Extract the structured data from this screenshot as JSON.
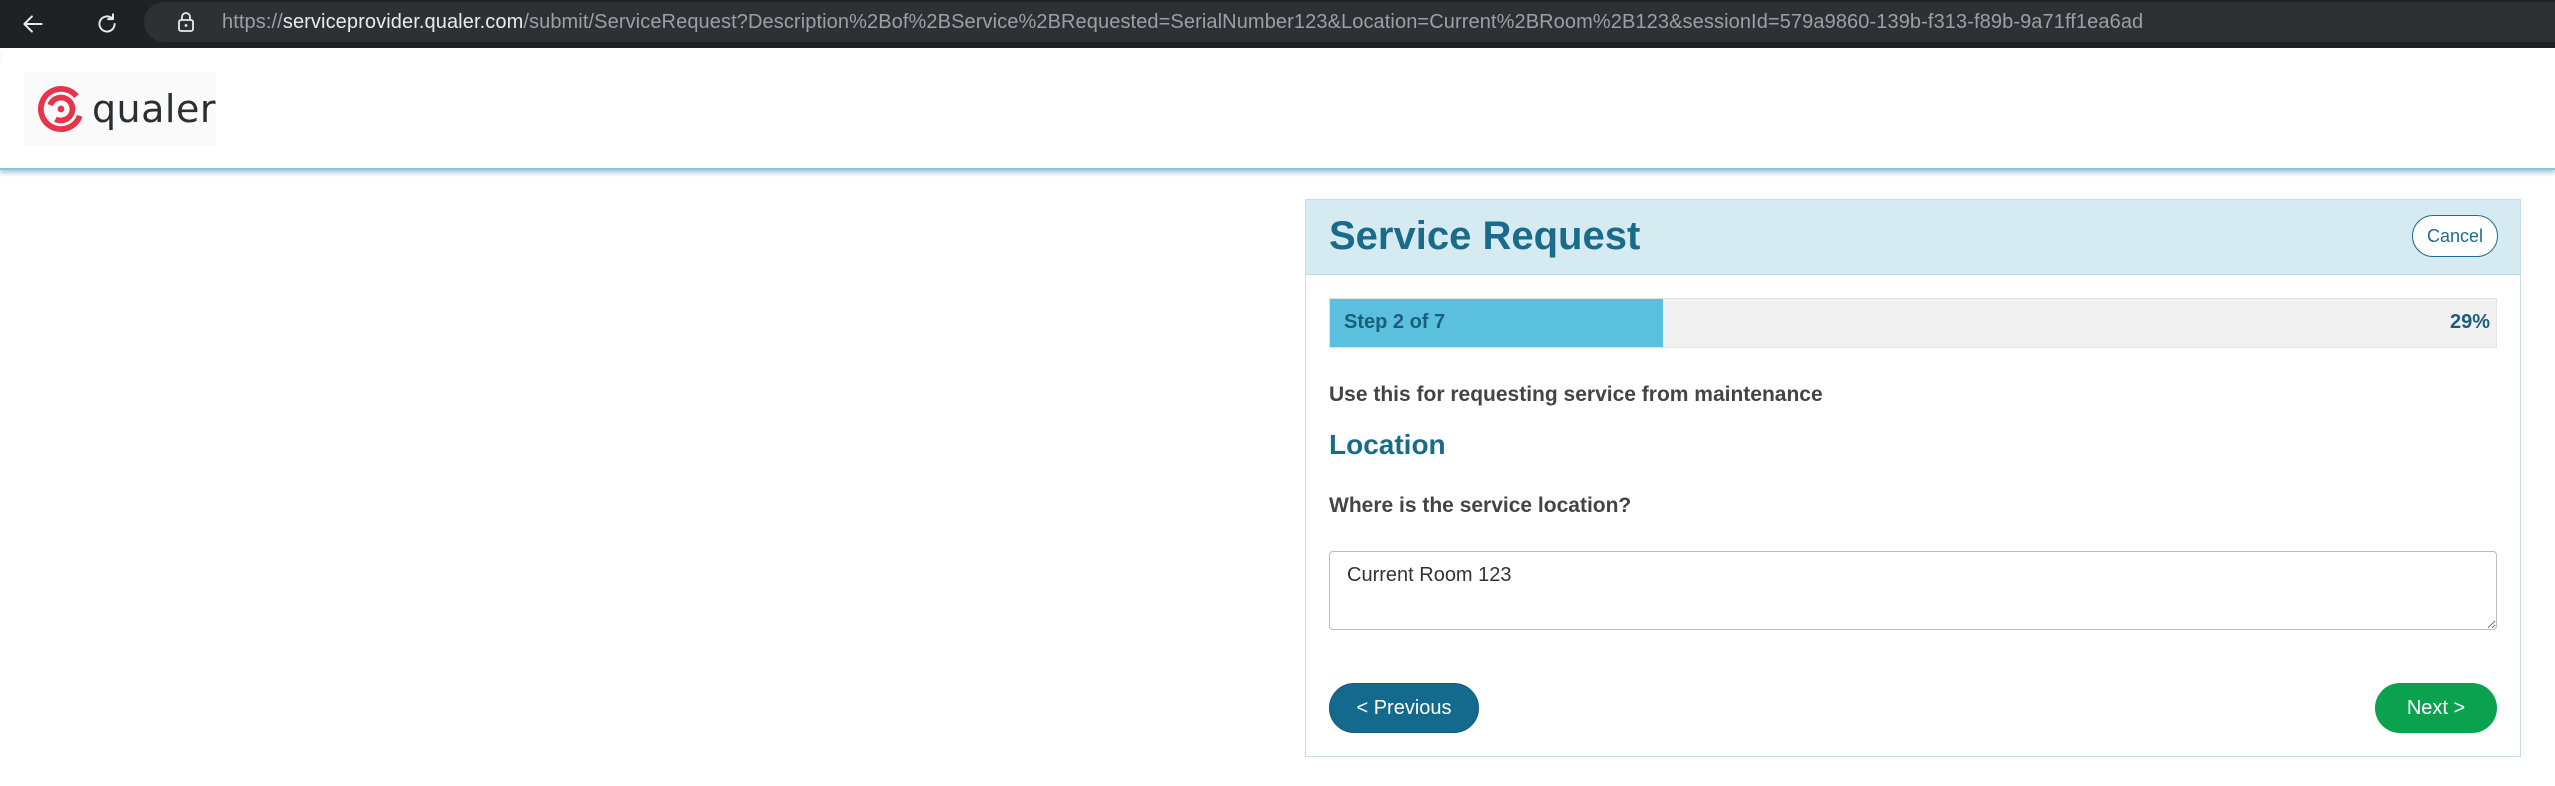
{
  "browser": {
    "url_scheme": "https://",
    "url_domain": "serviceprovider.qualer.com",
    "url_path": "/submit/ServiceRequest?Description%2Bof%2BService%2BRequested=SerialNumber123&Location=Current%2BRoom%2B123&sessionId=579a9860-139b-f313-f89b-9a71ff1ea6ad",
    "icons": [
      "back-arrow-icon",
      "reload-icon",
      "lock-icon"
    ]
  },
  "header": {
    "logo_text": "qualer",
    "logo_color": "#e8344b"
  },
  "form": {
    "title": "Service Request",
    "cancel_label": "Cancel",
    "progress": {
      "step_text": "Step 2 of 7",
      "percent_text": "29%",
      "percent_value": 0.286,
      "fill_color": "#5bc0de"
    },
    "description": "Use this for requesting service from maintenance",
    "section_title": "Location",
    "question": "Where is the service location?",
    "answer_value": "Current Room 123",
    "previous_label": "< Previous",
    "next_label": "Next >"
  },
  "colors": {
    "accent": "#196b8a",
    "previous_button": "#146a8c",
    "next_button": "#0aa24e",
    "card_header": "#d5eaf1"
  }
}
